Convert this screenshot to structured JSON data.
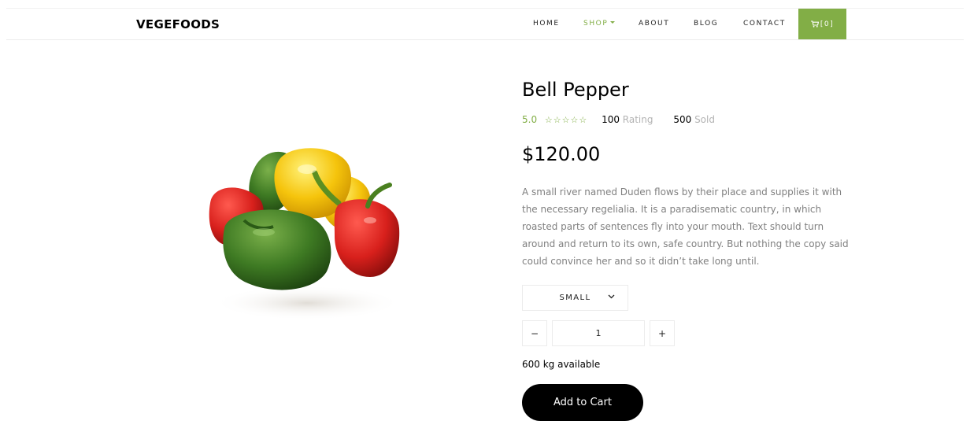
{
  "brand": "VEGEFOODS",
  "nav": {
    "home": "HOME",
    "shop": "SHOP",
    "about": "ABOUT",
    "blog": "BLOG",
    "contact": "CONTACT",
    "cart_label": "[0]",
    "cart_icon": "cart-icon"
  },
  "product": {
    "title": "Bell Pepper",
    "rating_value": "5.0",
    "stars": "☆☆☆☆☆",
    "rating_count": "100",
    "rating_label": "Rating",
    "sold_count": "500",
    "sold_label": "Sold",
    "price": "$120.00",
    "description": "A small river named Duden flows by their place and supplies it with the necessary regelialia. It is a paradisematic country, in which roasted parts of sentences fly into your mouth. Text should turn around and return to its own, safe country. But nothing the copy said could convince her and so it didn’t take long until.",
    "size_selected": "SMALL",
    "qty_minus": "−",
    "qty_plus": "+",
    "quantity": "1",
    "available": "600 kg available",
    "add_to_cart": "Add to Cart"
  },
  "colors": {
    "accent": "#82ae46",
    "button_dark": "#000000",
    "muted_text": "#808080"
  }
}
